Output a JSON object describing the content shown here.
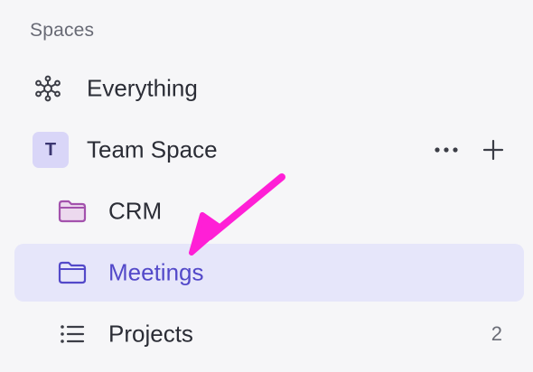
{
  "sidebar": {
    "section_title": "Spaces",
    "items": [
      {
        "label": "Everything",
        "icon": "hub-icon"
      },
      {
        "label": "Team Space",
        "avatar": "T",
        "icon": "space-avatar"
      },
      {
        "label": "CRM",
        "icon": "folder-icon"
      },
      {
        "label": "Meetings",
        "icon": "folder-icon",
        "selected": true
      },
      {
        "label": "Projects",
        "icon": "list-icon",
        "count": "2"
      }
    ]
  },
  "colors": {
    "background": "#f6f6f8",
    "selected_background": "#e6e6fa",
    "selected_text": "#5349c9",
    "avatar_background": "#d9d6f8",
    "annotation_arrow": "#ff1fd6"
  }
}
